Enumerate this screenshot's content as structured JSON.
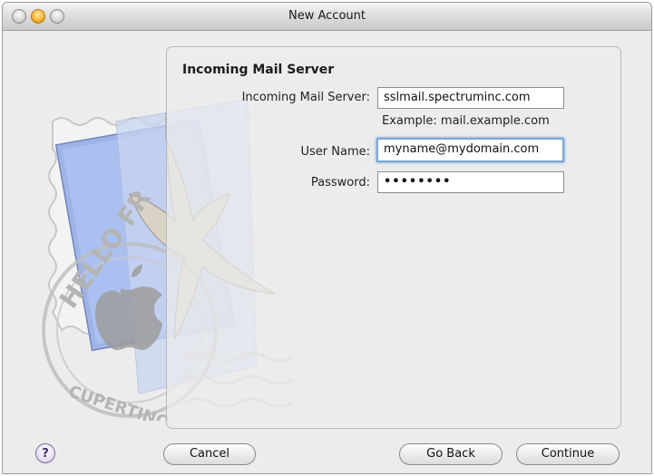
{
  "window": {
    "title": "New Account"
  },
  "section": {
    "title": "Incoming Mail Server"
  },
  "form": {
    "server": {
      "label": "Incoming Mail Server:",
      "value": "sslmail.spectruminc.com",
      "hint": "Example: mail.example.com"
    },
    "username": {
      "label": "User Name:",
      "value": "myname@mydomain.com"
    },
    "password": {
      "label": "Password:",
      "value": "••••••••"
    }
  },
  "buttons": {
    "help": "?",
    "cancel": "Cancel",
    "back": "Go Back",
    "continue": "Continue"
  },
  "stamp": {
    "text_top": "HELLO FR",
    "text_bottom": "CUPERTINO CA"
  },
  "icons": {
    "help": "help-icon",
    "bird": "hawk-image",
    "stamp": "stamp-image",
    "apple": "apple-logo-icon"
  }
}
